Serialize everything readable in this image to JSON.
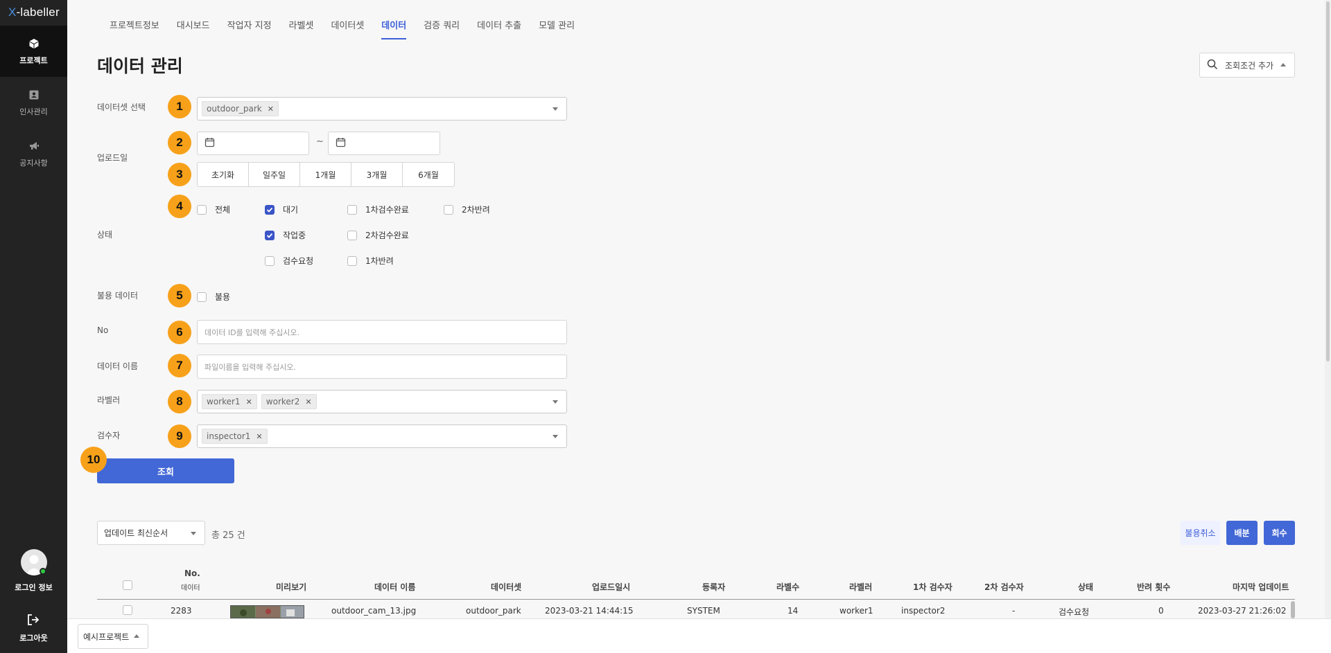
{
  "app": {
    "logo_prefix": "X",
    "logo_rest": "-labeller"
  },
  "sidebar": {
    "items": [
      {
        "label": "프로젝트",
        "icon": "cube-icon",
        "active": true
      },
      {
        "label": "인사관리",
        "icon": "id-card-icon",
        "active": false
      },
      {
        "label": "공지사항",
        "icon": "megaphone-icon",
        "active": false
      }
    ],
    "login_label": "로그인 정보",
    "logout_label": "로그아웃"
  },
  "tabs": [
    "프로젝트정보",
    "대시보드",
    "작업자 지정",
    "라벨셋",
    "데이터셋",
    "데이터",
    "검증 쿼리",
    "데이터 추출",
    "모델 관리"
  ],
  "active_tab": "데이터",
  "page_title": "데이터 관리",
  "condition_add": "조회조건 추가",
  "filters": {
    "dataset": {
      "label": "데이터셋 선택",
      "chips": [
        "outdoor_park"
      ]
    },
    "upload_date": {
      "label": "업로드일",
      "tilde": "~",
      "periods": [
        "초기화",
        "일주일",
        "1개월",
        "3개월",
        "6개월"
      ]
    },
    "status": {
      "label": "상태",
      "options": [
        {
          "label": "전체",
          "checked": false
        },
        {
          "label": "대기",
          "checked": true
        },
        {
          "label": "작업중",
          "checked": true
        },
        {
          "label": "검수요청",
          "checked": false
        },
        {
          "label": "1차검수완료",
          "checked": false
        },
        {
          "label": "2차검수완료",
          "checked": false
        },
        {
          "label": "1차반려",
          "checked": false
        },
        {
          "label": "2차반려",
          "checked": false
        }
      ]
    },
    "unused": {
      "label": "불용 데이터",
      "option": "불용"
    },
    "no": {
      "label": "No",
      "placeholder": "데이터 ID를 입력해 주십시오."
    },
    "data_name": {
      "label": "데이터 이름",
      "placeholder": "파일이름을 입력해 주십시오."
    },
    "labeller": {
      "label": "라벨러",
      "chips": [
        "worker1",
        "worker2"
      ]
    },
    "inspector": {
      "label": "검수자",
      "chips": [
        "inspector1"
      ]
    }
  },
  "badges": [
    "1",
    "2",
    "3",
    "4",
    "5",
    "6",
    "7",
    "8",
    "9",
    "10"
  ],
  "search_button": "조회",
  "list": {
    "sort": "업데이트 최신순서",
    "total": "총 25 건",
    "actions": {
      "unuse_cancel": "불용취소",
      "distribute": "배분",
      "retrieve": "회수"
    }
  },
  "table": {
    "headers": {
      "no": "No.",
      "no_sub": "데이터",
      "preview": "미리보기",
      "name": "데이터 이름",
      "dataset": "데이터셋",
      "uploaded": "업로드일시",
      "registrant": "등록자",
      "label_count": "라벨수",
      "labeller": "라벨러",
      "inspector1": "1차 검수자",
      "inspector2": "2차 검수자",
      "status": "상태",
      "reject_count": "반려 횟수",
      "last_update": "마지막 업데이트"
    },
    "rows": [
      {
        "no": "2283",
        "name": "outdoor_cam_13.jpg",
        "dataset": "outdoor_park",
        "uploaded": "2023-03-21 14:44:15",
        "registrant": "SYSTEM",
        "label_count": "14",
        "labeller": "worker1",
        "inspector1": "inspector2",
        "inspector2": "-",
        "status": "검수요청",
        "reject_count": "0",
        "last_update": "2023-03-27 21:26:02"
      }
    ]
  },
  "project_select": "예시프로젝트",
  "colors": {
    "accent": "#4267d6",
    "badge": "#f7a11a",
    "sidebar": "#232323"
  }
}
